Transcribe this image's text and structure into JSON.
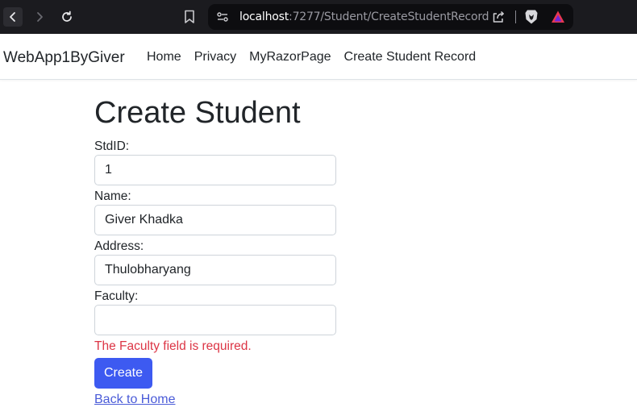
{
  "browser": {
    "url_host": "localhost",
    "url_rest": ":7277/Student/CreateStudentRecord"
  },
  "navbar": {
    "brand": "WebApp1ByGiver",
    "links": [
      "Home",
      "Privacy",
      "MyRazorPage",
      "Create Student Record"
    ]
  },
  "form": {
    "title": "Create Student",
    "fields": [
      {
        "label": "StdID:",
        "value": "1"
      },
      {
        "label": "Name:",
        "value": "Giver Khadka"
      },
      {
        "label": "Address:",
        "value": "Thulobharyang"
      },
      {
        "label": "Faculty:",
        "value": ""
      }
    ],
    "validation_message": "The Faculty field is required.",
    "submit_label": "Create",
    "back_link": "Back to Home"
  },
  "colors": {
    "chrome_bg": "#1b1b1f",
    "primary_button": "#3d5af1",
    "error_text": "#dc3545",
    "link": "#4a5bd8"
  },
  "icons": [
    "back-arrow-icon",
    "forward-arrow-icon",
    "reload-icon",
    "bookmark-icon",
    "site-settings-icon",
    "share-icon",
    "brave-shields-icon",
    "brave-rewards-icon"
  ]
}
